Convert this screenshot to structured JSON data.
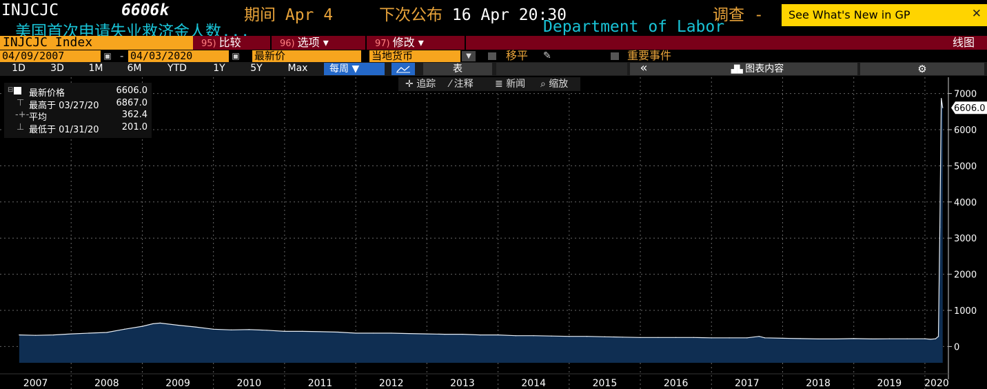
{
  "header": {
    "ticker": "INJCJC",
    "price": "6606k",
    "period": "期间 Apr 4",
    "next_release_label": "下次公布",
    "next_release_value": "16 Apr 20:30",
    "survey": "调查",
    "survey_suffix": "-",
    "name": "美国首次申请失业救济金人数...",
    "source": "Department of Labor",
    "gp_banner": "See What's New in GP",
    "gp_close": "✕"
  },
  "menu": {
    "index_field": "INJCJC Index",
    "compare": {
      "num": "95)",
      "label": "比较"
    },
    "options": {
      "num": "96)",
      "label": "选项 ▾"
    },
    "modify": {
      "num": "97)",
      "label": "修改 ▾"
    },
    "line_graph": "线图"
  },
  "controls": {
    "start_date": "04/09/2007",
    "dash": "-",
    "end_date": "04/03/2020",
    "price_type": "最新价",
    "currency": "当地货币",
    "moving_avg": "移平",
    "key_events": "重要事件"
  },
  "toolbar": {
    "ranges": [
      "1D",
      "3D",
      "1M",
      "6M",
      "YTD",
      "1Y",
      "5Y",
      "Max"
    ],
    "frequency": "每周 ▼",
    "table": "表",
    "collapse": "«",
    "chart_contents": "图表内容",
    "settings_icon": "gear-icon",
    "tools": [
      "追踪",
      "注释",
      "新闻",
      "缩放"
    ]
  },
  "legend": {
    "last_label": "最新价格",
    "last_value": "6606.0",
    "high_label": "最高于 03/27/20",
    "high_value": "6867.0",
    "avg_label": "平均",
    "avg_value": "362.4",
    "low_label": "最低于 01/31/20",
    "low_value": "201.0"
  },
  "chart_data": {
    "type": "area",
    "ylim": [
      -450,
      7450
    ],
    "yticks": [
      0,
      1000,
      2000,
      3000,
      4000,
      5000,
      6000,
      7000
    ],
    "ytick_labels": [
      "0",
      "1000",
      "2000",
      "3000",
      "4000",
      "5000",
      "6000",
      "7000"
    ],
    "last_label": "6606.0",
    "years": [
      "2007",
      "2008",
      "2009",
      "2010",
      "2011",
      "2012",
      "2013",
      "2014",
      "2015",
      "2016",
      "2017",
      "2018",
      "2019",
      "2020"
    ],
    "x": [
      2007.27,
      2007.5,
      2007.75,
      2008.0,
      2008.25,
      2008.5,
      2008.75,
      2009.0,
      2009.15,
      2009.25,
      2009.5,
      2009.75,
      2010.0,
      2010.25,
      2010.5,
      2010.75,
      2011.0,
      2011.25,
      2011.5,
      2011.75,
      2012.0,
      2012.25,
      2012.5,
      2012.75,
      2013.0,
      2013.25,
      2013.5,
      2013.75,
      2014.0,
      2014.25,
      2014.5,
      2014.75,
      2015.0,
      2015.25,
      2015.5,
      2015.75,
      2016.0,
      2016.25,
      2016.5,
      2016.75,
      2017.0,
      2017.25,
      2017.5,
      2017.67,
      2017.75,
      2018.0,
      2018.25,
      2018.5,
      2018.75,
      2019.0,
      2019.25,
      2019.5,
      2019.75,
      2020.0,
      2020.08,
      2020.15,
      2020.19,
      2020.21,
      2020.23,
      2020.25
    ],
    "y": [
      320,
      310,
      320,
      350,
      370,
      390,
      480,
      560,
      630,
      650,
      590,
      540,
      480,
      460,
      470,
      450,
      420,
      420,
      410,
      400,
      370,
      370,
      370,
      360,
      350,
      340,
      340,
      320,
      320,
      300,
      300,
      290,
      280,
      280,
      270,
      260,
      250,
      250,
      250,
      250,
      240,
      240,
      240,
      280,
      240,
      230,
      220,
      210,
      210,
      220,
      210,
      215,
      215,
      215,
      201,
      215,
      281,
      3307,
      6867,
      6606
    ]
  }
}
